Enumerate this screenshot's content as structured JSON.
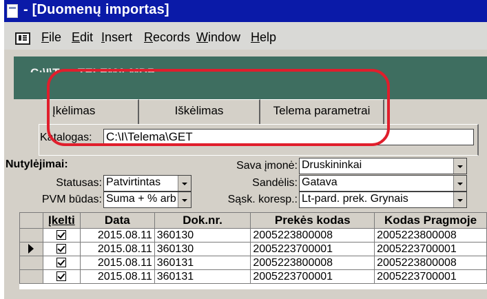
{
  "window": {
    "title": " - [Duomenų importas]"
  },
  "menu": {
    "items": [
      "File",
      "Edit",
      "Insert",
      "Records",
      "Window",
      "Help"
    ]
  },
  "header": {
    "path": "C:\\I\\T......TELEMA.MDB"
  },
  "tabs": [
    {
      "label": "Įkėlimas"
    },
    {
      "label": "Iškėlimas"
    },
    {
      "label": "Telema parametrai"
    }
  ],
  "katalogas": {
    "label": "Katalogas:",
    "value": "C:\\I\\Telema\\GET"
  },
  "defaults": {
    "title": "Nutylėjimai:",
    "statusas": {
      "label": "Statusas:",
      "value": "Patvirtintas"
    },
    "pvm": {
      "label": "PVM būdas:",
      "value": "Suma + % arb"
    },
    "imone": {
      "label": "Sava įmonė:",
      "value": "Druskininkai"
    },
    "sandelis": {
      "label": "Sandėlis:",
      "value": "Gatava"
    },
    "sask": {
      "label": "Sąsk. koresp.:",
      "value": "Lt-pard. prek. Grynais"
    }
  },
  "grid": {
    "headers": [
      "Įkelti",
      "Data",
      "Dok.nr.",
      "Prekės kodas",
      "Kodas Pragmoje"
    ],
    "rows": [
      {
        "checked": true,
        "date": "2015.08.11",
        "doc": "360130",
        "code": "2005223800008",
        "pragma": "2005223800008",
        "current": false
      },
      {
        "checked": true,
        "date": "2015.08.11",
        "doc": "360130",
        "code": "2005223700001",
        "pragma": "2005223700001",
        "current": true
      },
      {
        "checked": true,
        "date": "2015.08.11",
        "doc": "360131",
        "code": "2005223800008",
        "pragma": "2005223800008",
        "current": false
      },
      {
        "checked": true,
        "date": "2015.08.11",
        "doc": "360131",
        "code": "2005223700001",
        "pragma": "2005223700001",
        "current": false
      }
    ]
  },
  "colors": {
    "titlebar": "#0a1aa8",
    "header": "#3e6e60",
    "highlight": "#e01e2c",
    "form": "#d4d0c8"
  }
}
